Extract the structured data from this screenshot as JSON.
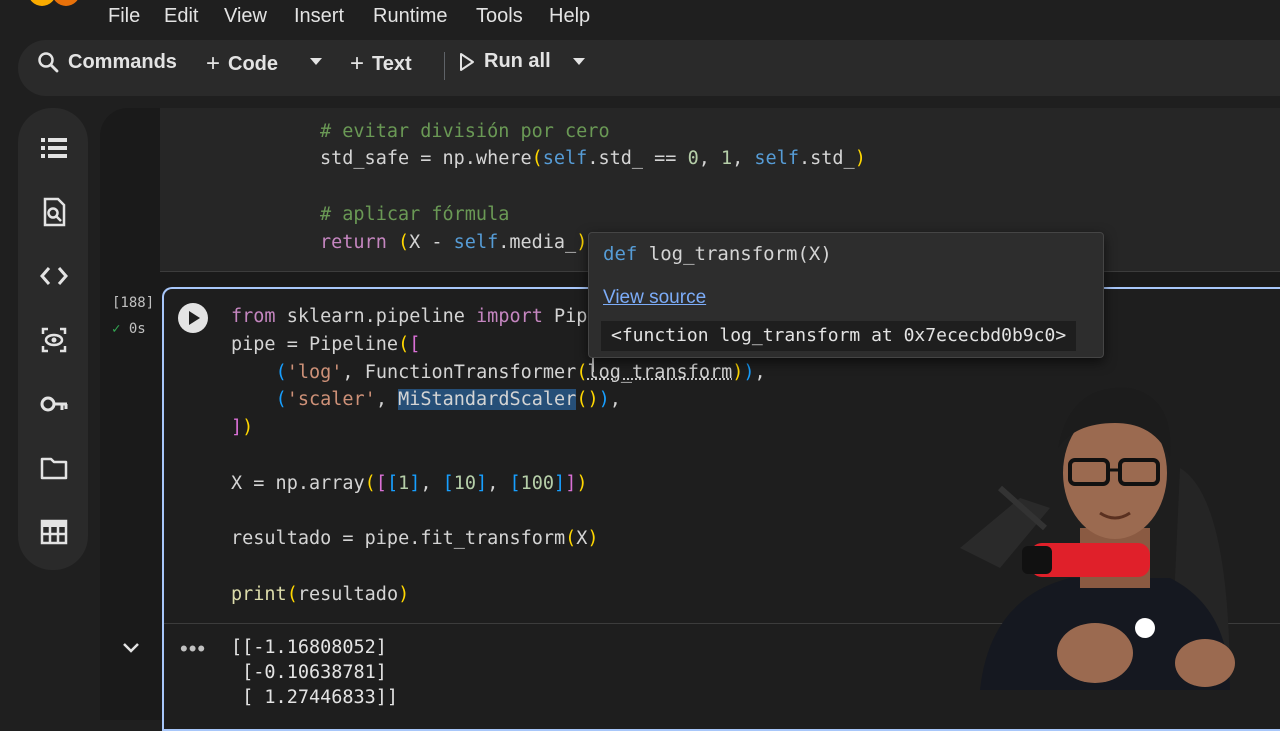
{
  "menu": {
    "items": [
      "File",
      "Edit",
      "View",
      "Insert",
      "Runtime",
      "Tools",
      "Help"
    ]
  },
  "toolbar": {
    "commands_label": "Commands",
    "code_label": "Code",
    "text_label": "Text",
    "run_all_label": "Run all"
  },
  "rail": {
    "icons": [
      "table-of-contents-icon",
      "find-icon",
      "code-snippets-icon",
      "variables-icon",
      "secrets-key-icon",
      "files-folder-icon",
      "data-table-icon"
    ]
  },
  "cell_top": {
    "lines": [
      "# evitar división por cero",
      "std_safe = np.where(self.std_ == 0, 1, self.std_)",
      "",
      "# aplicar fórmula",
      "return (X - self.media_)"
    ]
  },
  "cell_main": {
    "exec_count": "[188]",
    "exec_time": "0s",
    "code": {
      "l1_from": "from",
      "l1_mod": " sklearn.pipeline ",
      "l1_import": "import",
      "l1_rest": " Pip",
      "l2": "pipe = Pipeline([",
      "l3_str": "'log'",
      "l3_fn": "FunctionTransformer",
      "l3_arg": "log_transform",
      "l4_str": "'scaler'",
      "l4_cls": "MiStandardScaler",
      "l5": "])",
      "l6_a": "X = np.array(",
      "l6_n1": "1",
      "l6_n2": "10",
      "l6_n3": "100",
      "l7": "resultado = pipe.fit_transform(X)",
      "l8_fn": "print",
      "l8_arg": "resultado"
    },
    "output": [
      "[[-1.16808052]",
      " [-0.10638781]",
      " [ 1.27446833]]"
    ]
  },
  "tooltip": {
    "def_kw": "def",
    "signature": "log_transform(X)",
    "view_source": "View source",
    "repr": "<function log_transform at 0x7ececbd0b9c0>"
  },
  "colors": {
    "accent": "#a8c7fa",
    "background": "#1f1f1f",
    "comment": "#6a9955",
    "keyword": "#c586c0",
    "number": "#b5cea8",
    "string": "#ce9178",
    "selection": "#264f78"
  }
}
